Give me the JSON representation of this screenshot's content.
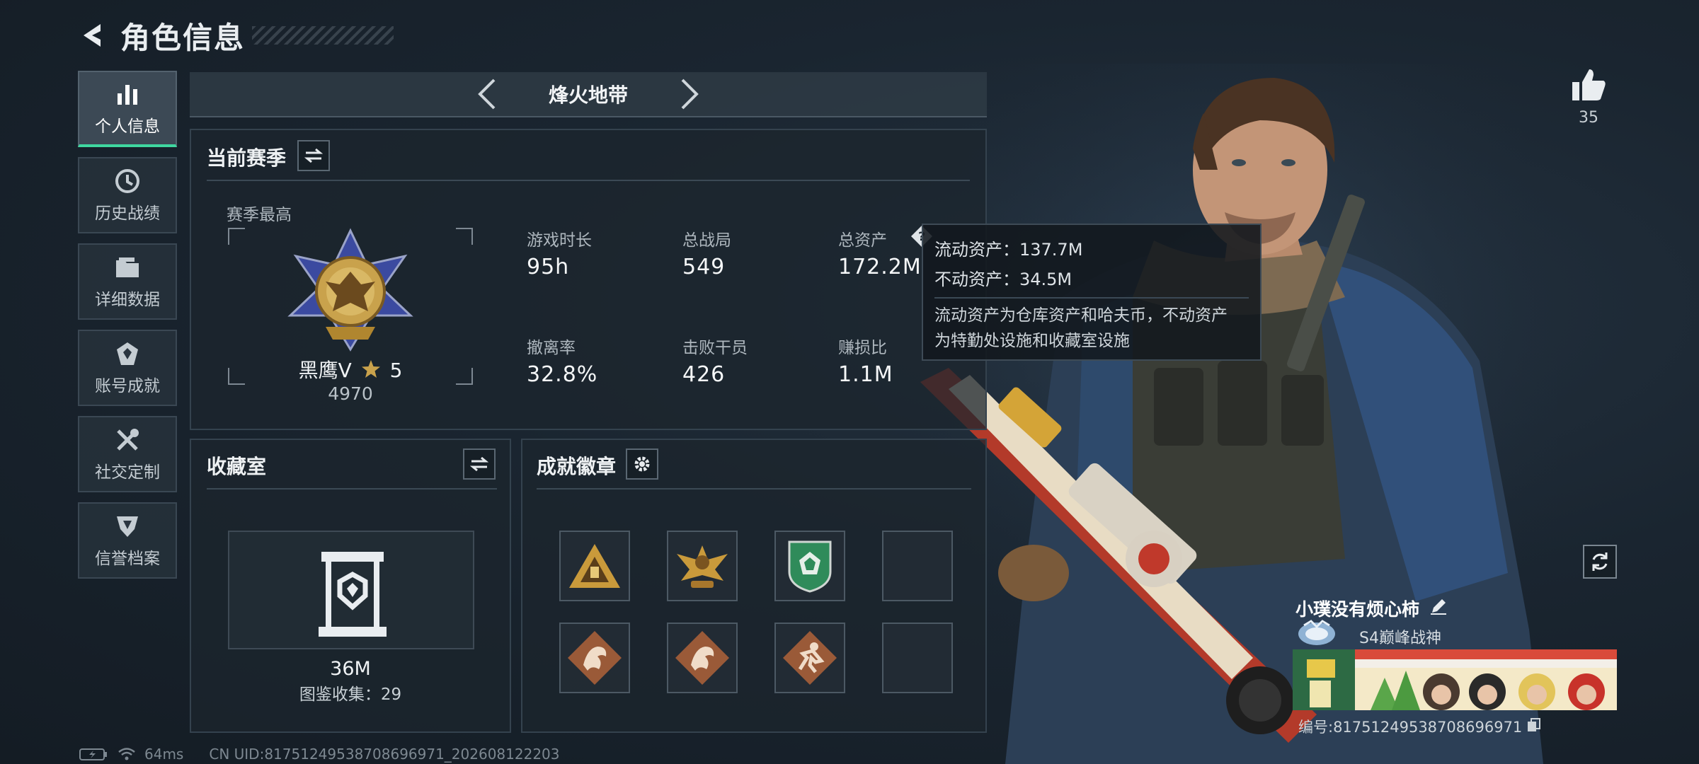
{
  "header": {
    "title": "角色信息"
  },
  "sidebar": {
    "items": [
      {
        "label": "个人信息",
        "icon": "bar-chart-icon",
        "active": true
      },
      {
        "label": "历史战绩",
        "icon": "clock-history-icon",
        "active": false
      },
      {
        "label": "详细数据",
        "icon": "folder-icon",
        "active": false
      },
      {
        "label": "账号成就",
        "icon": "achievement-icon",
        "active": false
      },
      {
        "label": "社交定制",
        "icon": "tools-icon",
        "active": false
      },
      {
        "label": "信誉档案",
        "icon": "shield-badge-icon",
        "active": false
      }
    ]
  },
  "mode": {
    "title": "烽火地带"
  },
  "season": {
    "title": "当前赛季",
    "best_label": "赛季最高",
    "rank_name": "黑鹰V",
    "rank_stars": "5",
    "rank_score": "4970",
    "stats": [
      {
        "label": "游戏时长",
        "value": "95h"
      },
      {
        "label": "总战局",
        "value": "549"
      },
      {
        "label": "总资产",
        "value": "172.2M"
      },
      {
        "label": "撤离率",
        "value": "32.8%"
      },
      {
        "label": "击败干员",
        "value": "426"
      },
      {
        "label": "赚损比",
        "value": "1.1M"
      }
    ]
  },
  "tooltip": {
    "liquid": "流动资产：137.7M",
    "fixed": "不动资产：34.5M",
    "desc_line1": "流动资产为仓库资产和哈夫币，不动资产",
    "desc_line2": "为特勤处设施和收藏室设施"
  },
  "collection": {
    "title": "收藏室",
    "value": "36M",
    "catalog": "图鉴收集：29"
  },
  "achievements": {
    "title": "成就徽章",
    "badges": [
      {
        "icon": "pyramid-badge-icon",
        "color": "#c99a3b"
      },
      {
        "icon": "eagle-badge-icon",
        "color": "#c99a3b"
      },
      {
        "icon": "emerald-shield-badge-icon",
        "color": "#2f8b5a"
      },
      {
        "icon": "empty-slot",
        "color": ""
      },
      {
        "icon": "dragon-badge-icon",
        "color": "#b0603a"
      },
      {
        "icon": "dragon-badge-icon",
        "color": "#b0603a"
      },
      {
        "icon": "runner-badge-icon",
        "color": "#b0603a"
      },
      {
        "icon": "empty-slot",
        "color": ""
      }
    ]
  },
  "like": {
    "count": "35"
  },
  "player": {
    "name": "小璞没有烦心柿",
    "rank_title": "S4巅峰战神",
    "id": "编号:81751249538708696971"
  },
  "statusbar": {
    "ping": "64ms",
    "uid": "CN UID:81751249538708696971_202608122203"
  },
  "colors": {
    "accent": "#3fd7a0",
    "gold": "#c99a3b"
  }
}
